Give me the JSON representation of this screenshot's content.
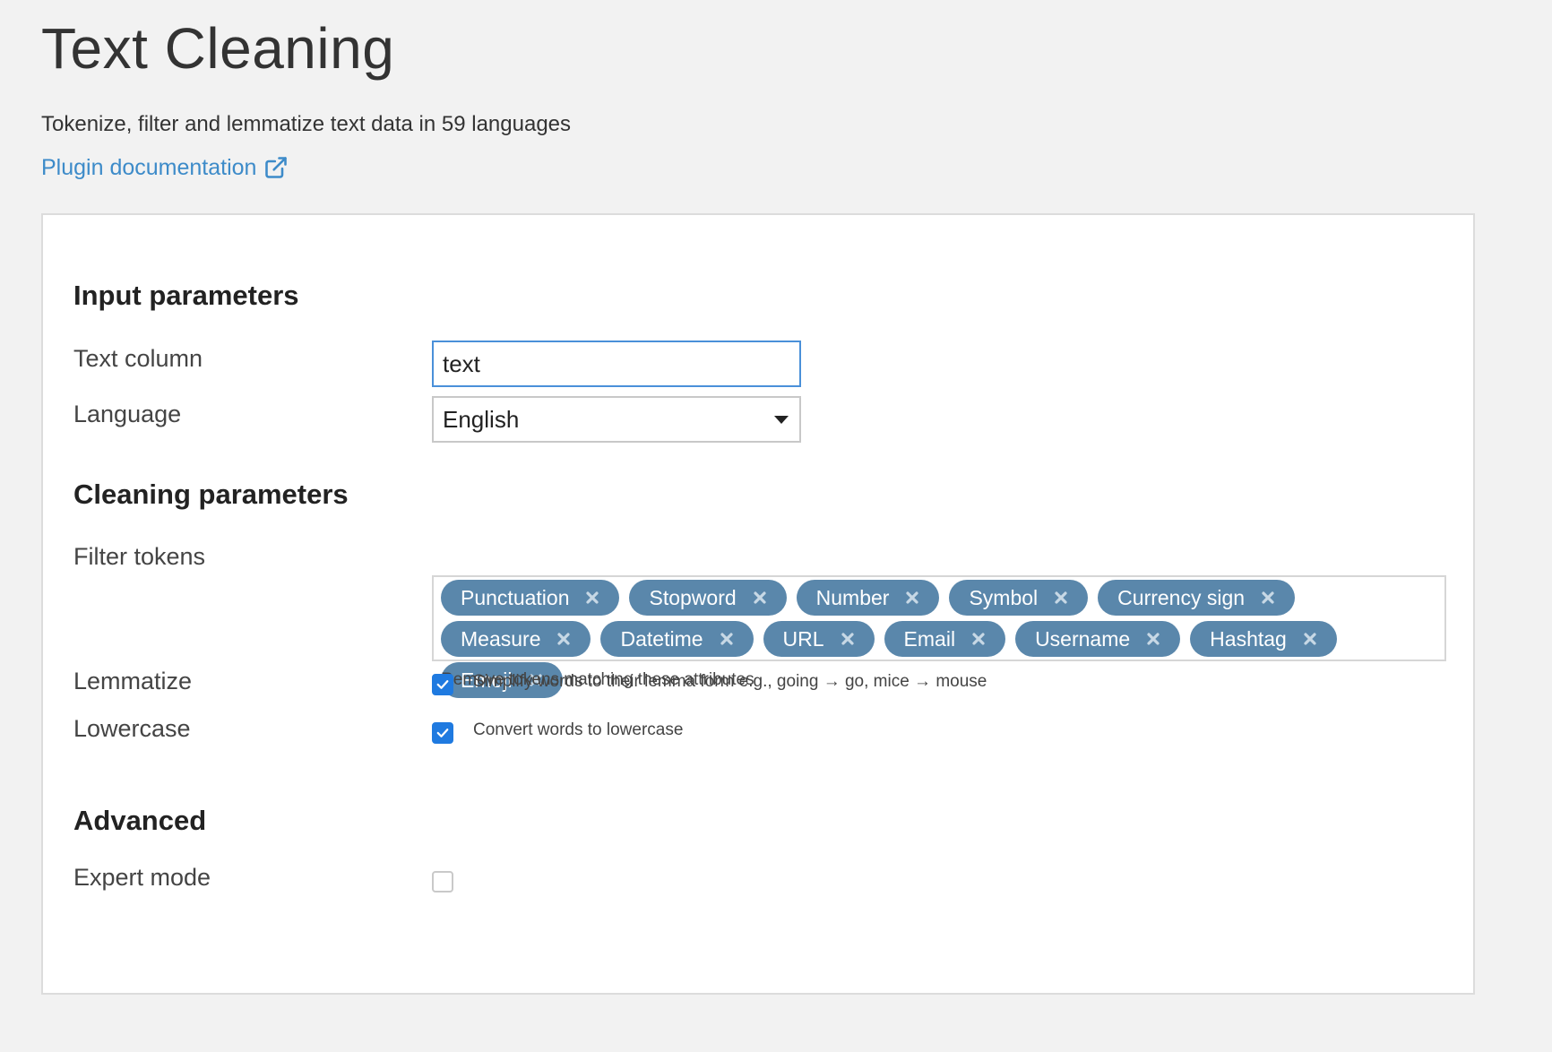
{
  "header": {
    "title": "Text Cleaning",
    "subtitle": "Tokenize, filter and lemmatize text data in 59 languages",
    "doc_link_label": "Plugin documentation"
  },
  "sections": {
    "input": "Input parameters",
    "cleaning": "Cleaning parameters",
    "advanced": "Advanced"
  },
  "fields": {
    "text_column": {
      "label": "Text column",
      "value": "text"
    },
    "language": {
      "label": "Language",
      "value": "English"
    },
    "filter_tokens": {
      "label": "Filter tokens",
      "tags": [
        "Punctuation",
        "Stopword",
        "Number",
        "Symbol",
        "Currency sign",
        "Measure",
        "Datetime",
        "URL",
        "Email",
        "Username",
        "Hashtag",
        "Emoji"
      ],
      "help": "Remove tokens matching these attributes"
    },
    "lemmatize": {
      "label": "Lemmatize",
      "checked": true,
      "description": "Simplify words to their lemma form e.g., going → go, mice → mouse"
    },
    "lowercase": {
      "label": "Lowercase",
      "checked": true,
      "description": "Convert words to lowercase"
    },
    "expert_mode": {
      "label": "Expert mode",
      "checked": false
    }
  },
  "colors": {
    "link": "#3d8bc9",
    "tag_bg": "#5a87ab",
    "checkbox": "#1f7ae0",
    "focus_border": "#4a90d9"
  },
  "icons": {
    "external_link": "external-link-icon",
    "tag_remove": "close-icon",
    "dropdown": "caret-down-icon",
    "check": "checkmark-icon"
  }
}
